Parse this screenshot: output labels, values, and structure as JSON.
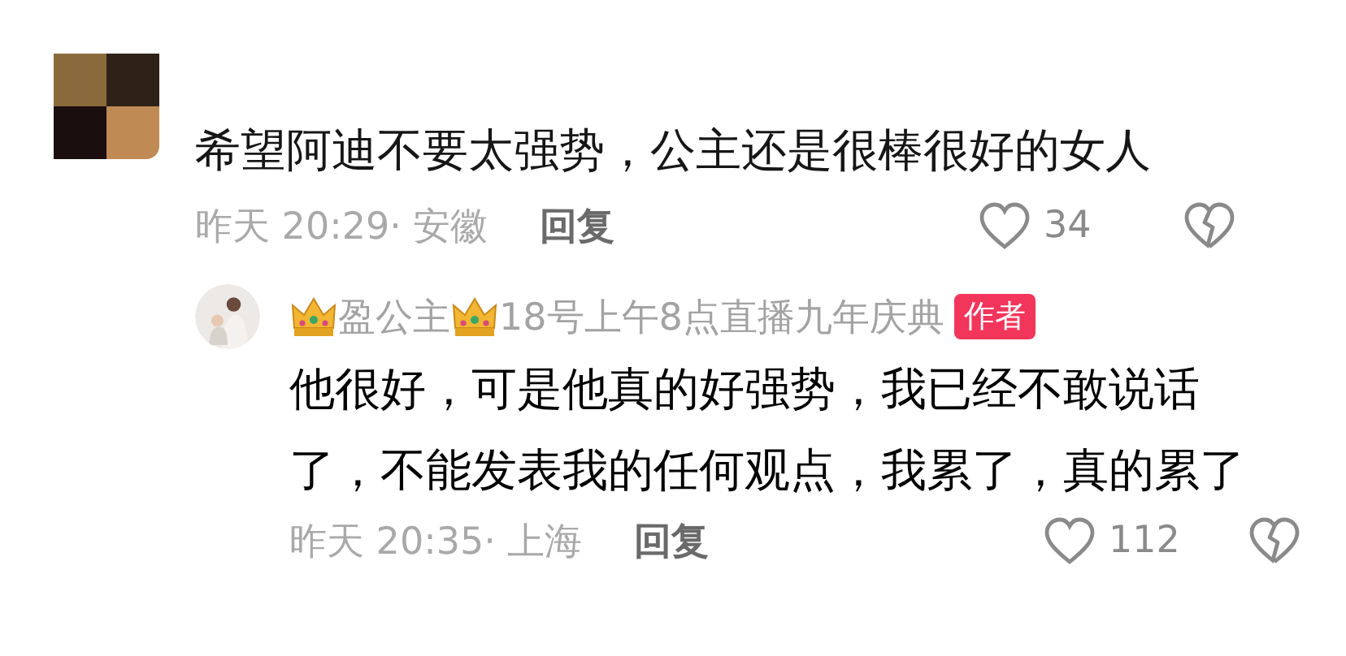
{
  "comments": [
    {
      "text": "希望阿迪不要太强势，公主还是很棒很好的女人",
      "time": "昨天 20:29·",
      "location": "安徽",
      "reply_label": "回复",
      "likes": "34",
      "replies": [
        {
          "name": "盈公主",
          "name_suffix": "18号上午8点直播九年庆典",
          "badge": "作者",
          "text": "他很好，可是他真的好强势，我已经不敢说话了，不能发表我的任何观点，我累了，真的累了",
          "time": "昨天 20:35·",
          "location": "上海",
          "reply_label": "回复",
          "likes": "112"
        }
      ]
    }
  ]
}
